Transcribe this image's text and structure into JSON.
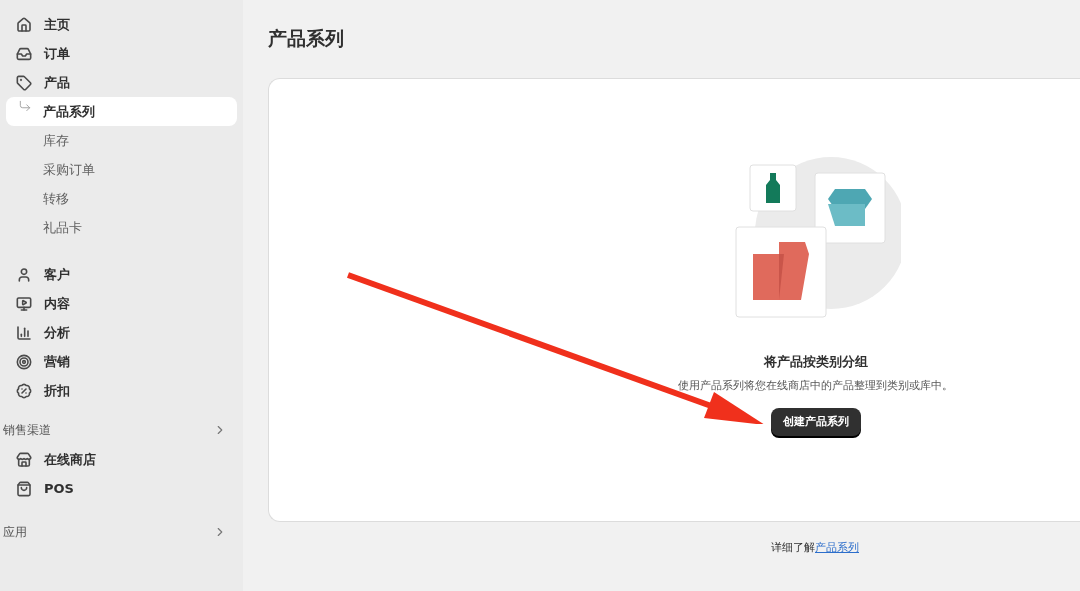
{
  "sidebar": {
    "items": [
      {
        "label": "主页",
        "selected": false
      },
      {
        "label": "订单",
        "selected": false
      },
      {
        "label": "产品",
        "selected": false,
        "children": [
          {
            "label": "产品系列",
            "selected": true
          },
          {
            "label": "库存",
            "selected": false
          },
          {
            "label": "采购订单",
            "selected": false
          },
          {
            "label": "转移",
            "selected": false
          },
          {
            "label": "礼品卡",
            "selected": false
          }
        ]
      },
      {
        "label": "客户",
        "selected": false
      },
      {
        "label": "内容",
        "selected": false
      },
      {
        "label": "分析",
        "selected": false
      },
      {
        "label": "营销",
        "selected": false
      },
      {
        "label": "折扣",
        "selected": false
      }
    ],
    "sections": [
      {
        "heading": "销售渠道",
        "items": [
          {
            "label": "在线商店",
            "selected": false
          },
          {
            "label": "POS",
            "selected": false
          }
        ]
      },
      {
        "heading": "应用"
      }
    ]
  },
  "page": {
    "title": "产品系列",
    "empty_state": {
      "heading": "将产品按类别分组",
      "description": "使用产品系列将您在线商店中的产品整理到类别或库中。",
      "button": "创建产品系列"
    },
    "footer": {
      "text": "详细了解",
      "link": "产品系列"
    }
  }
}
